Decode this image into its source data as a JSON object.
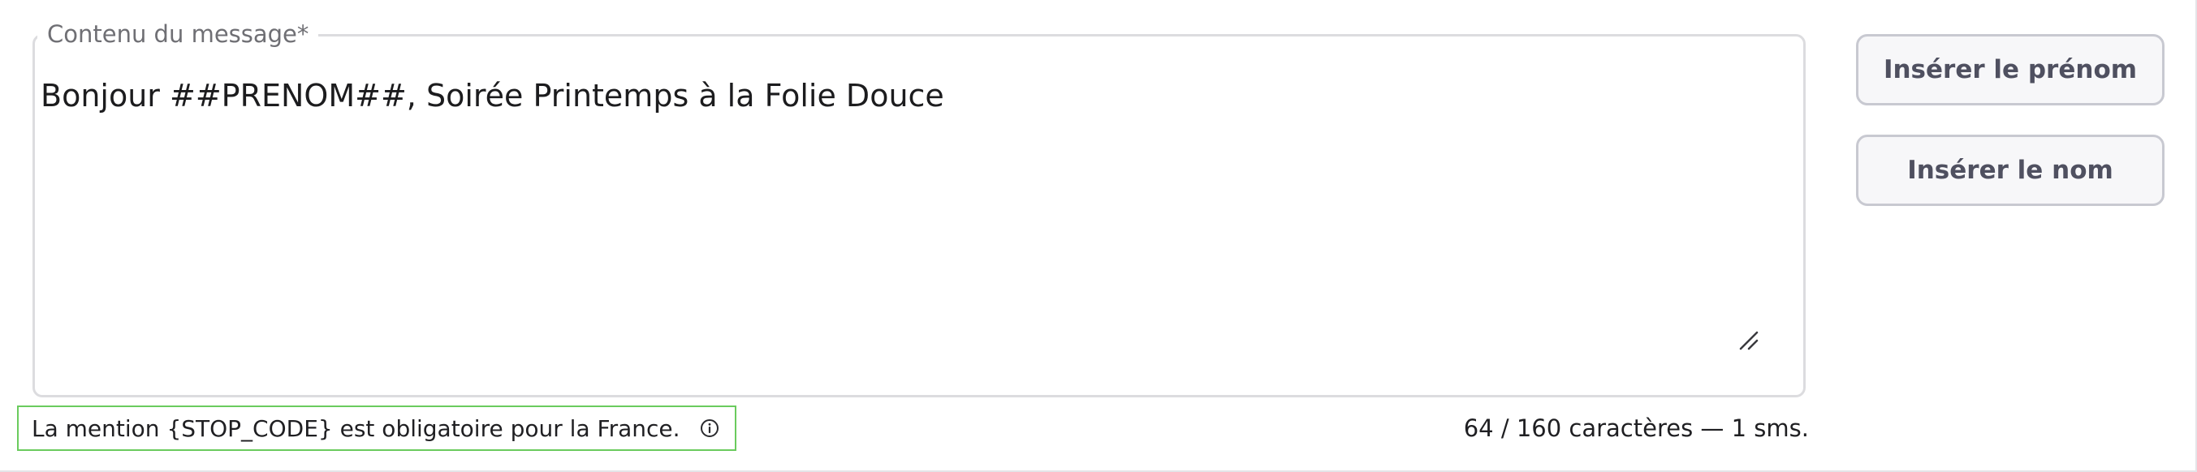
{
  "message": {
    "label": "Contenu du message*",
    "value": "Bonjour ##PRENOM##, Soirée Printemps à la Folie Douce"
  },
  "actions": {
    "insert_first_name": "Insérer le prénom",
    "insert_last_name": "Insérer le nom"
  },
  "hint": {
    "text": "La mention {STOP_CODE} est obligatoire pour la France.",
    "icon": "info-circle-icon"
  },
  "counter": {
    "text": "64 / 160 caractères — 1 sms."
  },
  "colors": {
    "field_border": "#dcdcdf",
    "button_border": "#c8c9d1",
    "button_bg": "#f7f7f9",
    "button_text": "#4f5060",
    "highlight_border": "#6acb5d"
  }
}
